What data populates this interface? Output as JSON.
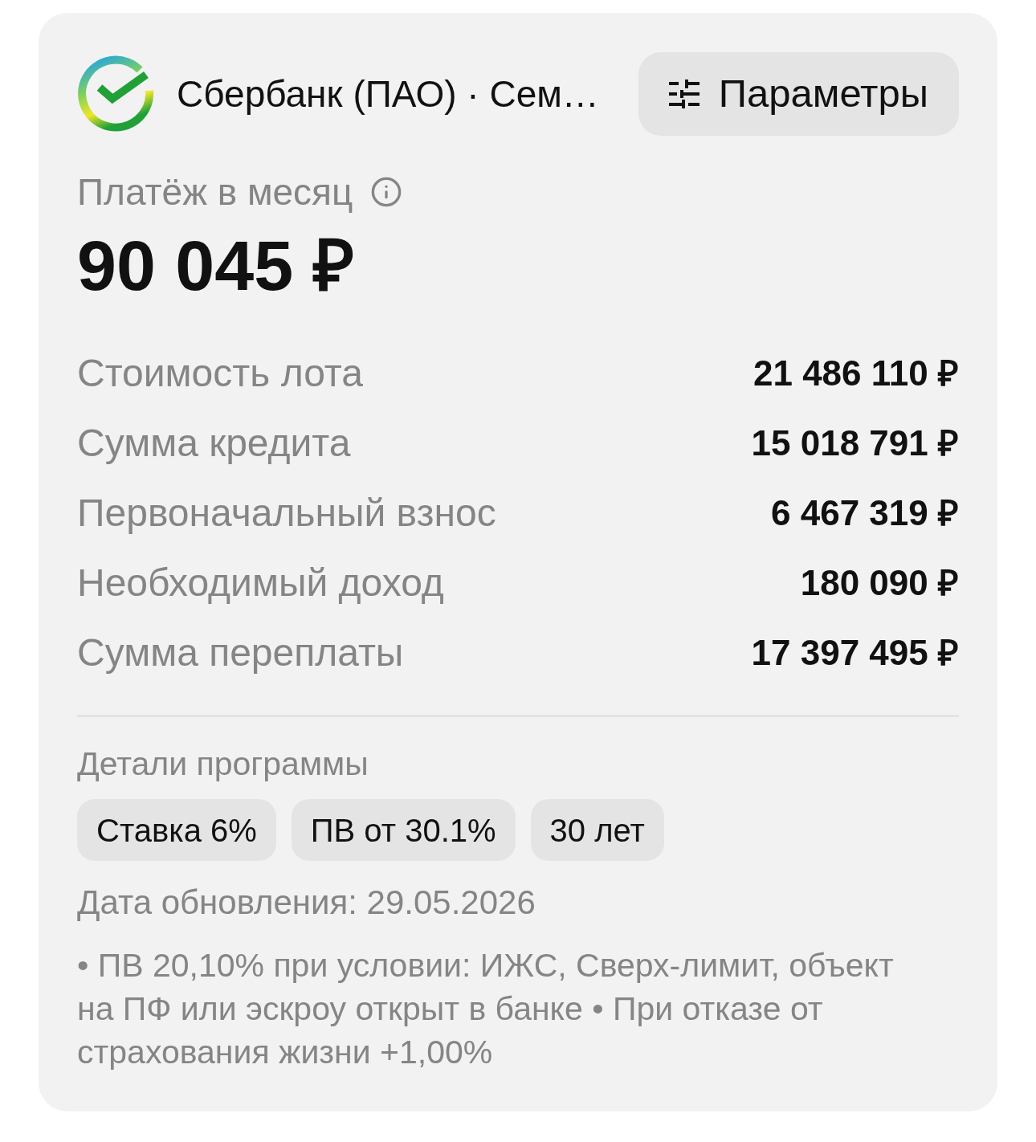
{
  "header": {
    "title": "Сбербанк (ПАО) · Сем…",
    "button": {
      "label": "Параметры"
    }
  },
  "payment": {
    "label": "Платёж в месяц",
    "amount": "90 045 ₽"
  },
  "details": [
    {
      "label": "Стоимость лота",
      "value": "21 486 110 ₽"
    },
    {
      "label": "Сумма кредита",
      "value": "15 018 791 ₽"
    },
    {
      "label": "Первоначальный взнос",
      "value": "6 467 319 ₽"
    },
    {
      "label": "Необходимый доход",
      "value": "180 090 ₽"
    },
    {
      "label": "Сумма переплаты",
      "value": "17 397 495 ₽"
    }
  ],
  "program": {
    "title": "Детали программы",
    "tags": [
      "Ставка 6%",
      "ПВ от 30.1%",
      "30 лет"
    ]
  },
  "updated": "Дата обновления: 29.05.2026",
  "note": "• ПВ 20,10% при условии: ИЖС, Сверх-лимит, объект на ПФ или эскроу открыт в банке • При отказе от страхования жизни +1,00%"
}
